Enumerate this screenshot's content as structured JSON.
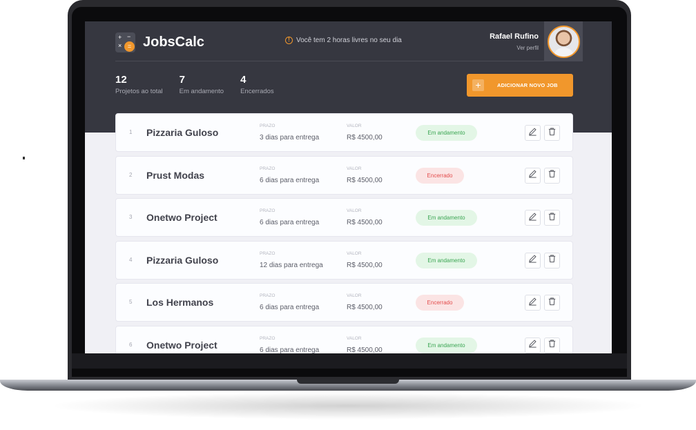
{
  "header": {
    "app_name": "JobsCalc",
    "logo_keys": [
      "+",
      "−",
      "×",
      "="
    ],
    "notice": "Você tem 2 horas livres no seu dia",
    "user_name": "Rafael Rufino",
    "profile_link": "Ver perfil"
  },
  "stats": [
    {
      "value": "12",
      "label": "Projetos ao total"
    },
    {
      "value": "7",
      "label": "Em andamento"
    },
    {
      "value": "4",
      "label": "Encerrados"
    }
  ],
  "add_button": {
    "icon": "+",
    "label": "ADICIONAR NOVO JOB"
  },
  "jobs": [
    {
      "id": "1",
      "name": "Pizzaria Guloso",
      "prazo_label": "PRAZO",
      "prazo": "3 dias para entrega",
      "valor_label": "VALOR",
      "valor": "R$ 4500,00",
      "status": "Em andamento",
      "status_type": "progress"
    },
    {
      "id": "2",
      "name": "Prust Modas",
      "prazo_label": "PRAZO",
      "prazo": "6 dias para entrega",
      "valor_label": "VALOR",
      "valor": "R$ 4500,00",
      "status": "Encerrado",
      "status_type": "closed"
    },
    {
      "id": "3",
      "name": "Onetwo Project",
      "prazo_label": "PRAZO",
      "prazo": "6 dias para entrega",
      "valor_label": "VALOR",
      "valor": "R$ 4500,00",
      "status": "Em andamento",
      "status_type": "progress"
    },
    {
      "id": "4",
      "name": "Pizzaria Guloso",
      "prazo_label": "PRAZO",
      "prazo": "12 dias para entrega",
      "valor_label": "VALOR",
      "valor": "R$ 4500,00",
      "status": "Em andamento",
      "status_type": "progress"
    },
    {
      "id": "5",
      "name": "Los Hermanos",
      "prazo_label": "PRAZO",
      "prazo": "6 dias para entrega",
      "valor_label": "VALOR",
      "valor": "R$ 4500,00",
      "status": "Encerrado",
      "status_type": "closed"
    },
    {
      "id": "6",
      "name": "Onetwo Project",
      "prazo_label": "PRAZO",
      "prazo": "6 dias para entrega",
      "valor_label": "VALOR",
      "valor": "R$ 4500,00",
      "status": "Em andamento",
      "status_type": "progress"
    }
  ],
  "colors": {
    "accent": "#f1972c",
    "header_bg": "#363740",
    "progress": "#3aa552",
    "closed": "#e34b4b"
  },
  "icons": {
    "edit": "pencil-icon",
    "delete": "trash-icon",
    "notice": "warning-icon"
  }
}
